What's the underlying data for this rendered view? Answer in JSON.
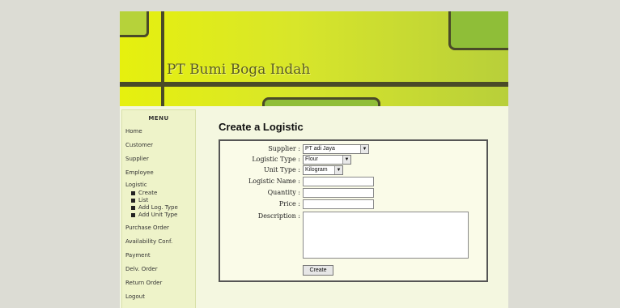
{
  "header": {
    "title": "PT Bumi Boga Indah"
  },
  "sidebar": {
    "menu_title": "MENU",
    "items": [
      {
        "label": "Home"
      },
      {
        "label": "Customer"
      },
      {
        "label": "Supplier"
      },
      {
        "label": "Employee"
      },
      {
        "label": "Logistic",
        "sub": [
          "Create",
          "List",
          "Add Log. Type",
          "Add Unit Type"
        ]
      },
      {
        "label": "Purchase Order"
      },
      {
        "label": "Availability Conf."
      },
      {
        "label": "Payment"
      },
      {
        "label": "Delv. Order"
      },
      {
        "label": "Return Order"
      },
      {
        "label": "Logout"
      }
    ]
  },
  "form": {
    "title": "Create a Logistic",
    "supplier": {
      "label": "Supplier :",
      "value": "PT adi Jaya"
    },
    "logistic_type": {
      "label": "Logistic Type :",
      "value": "Flour"
    },
    "unit_type": {
      "label": "Unit Type :",
      "value": "Kilogram"
    },
    "logistic_name": {
      "label": "Logistic Name :",
      "value": ""
    },
    "quantity": {
      "label": "Quantity :",
      "value": ""
    },
    "price": {
      "label": "Price :",
      "value": ""
    },
    "description": {
      "label": "Description :",
      "value": ""
    },
    "submit_label": "Create"
  },
  "colors": {
    "header_yellow": "#e6f00e",
    "header_green": "#8fbe38",
    "frame_dark": "#4a4a28",
    "content_bg": "#f4f7e0"
  },
  "icons": [
    "dropdown-arrow-icon",
    "bullet-icon"
  ]
}
